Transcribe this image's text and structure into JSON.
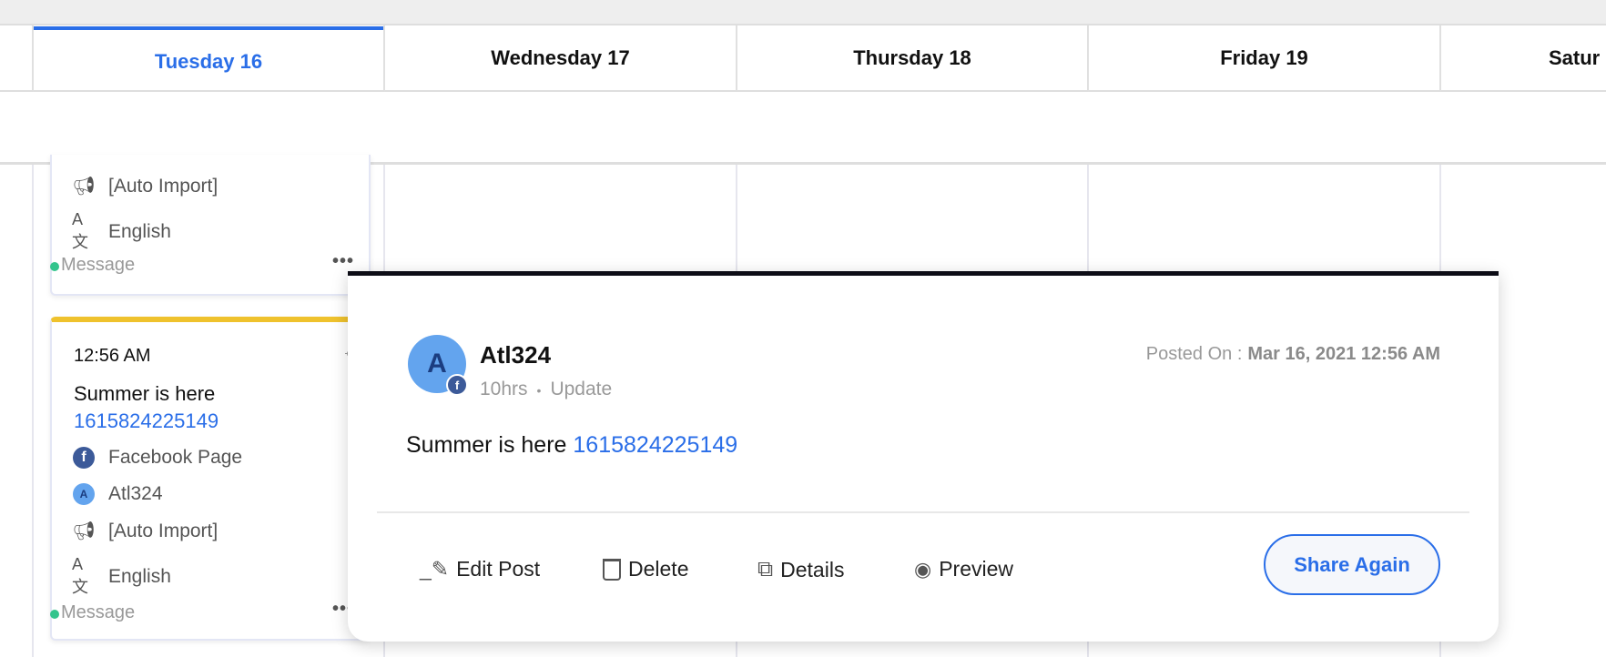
{
  "calendar": {
    "days": [
      {
        "label": "Tuesday 16",
        "active": true
      },
      {
        "label": "Wednesday 17"
      },
      {
        "label": "Thursday 18"
      },
      {
        "label": "Friday 19"
      },
      {
        "label": "Satur"
      }
    ],
    "active_color": "#2a6ee8"
  },
  "card1": {
    "campaign": "[Auto Import]",
    "language": "English",
    "status": "Message",
    "status_color": "#33c48d"
  },
  "card2": {
    "time": "12:56 AM",
    "title": "Summer is here",
    "link": "1615824225149",
    "channel": "Facebook Page",
    "account": "Atl324",
    "avatar_letter": "A",
    "campaign": "[Auto Import]",
    "language": "English",
    "status": "Message",
    "accent_color": "#efc22d"
  },
  "popup": {
    "avatar_letter": "A",
    "name": "Atl324",
    "age": "10hrs",
    "separator": "•",
    "type": "Update",
    "posted_label": "Posted On :",
    "posted_value": "Mar 16, 2021 12:56 AM",
    "body_text": "Summer is here",
    "body_link": "1615824225149",
    "actions": {
      "edit": "Edit Post",
      "delete": "Delete",
      "details": "Details",
      "preview": "Preview"
    },
    "share_again": "Share Again"
  }
}
